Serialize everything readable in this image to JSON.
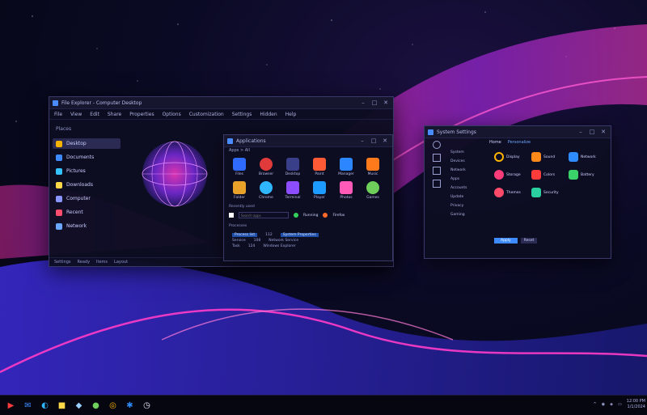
{
  "desktop": {
    "wallpaper": "neon-waves"
  },
  "explorer": {
    "title": "File Explorer - Computer Desktop",
    "menu": [
      "File",
      "View",
      "Edit",
      "Share",
      "Properties",
      "Options",
      "Customization",
      "Settings",
      "Hidden",
      "Help"
    ],
    "sidebar_header": "Places",
    "sidebar_items": [
      {
        "label": "Desktop",
        "icon": "folder-icon",
        "color": "#f4b400",
        "active": true
      },
      {
        "label": "Documents",
        "icon": "document-icon",
        "color": "#3d8bff",
        "active": false
      },
      {
        "label": "Pictures",
        "icon": "image-icon",
        "color": "#35c3ff",
        "active": false
      },
      {
        "label": "Downloads",
        "icon": "download-icon",
        "color": "#ffd84a",
        "active": false
      },
      {
        "label": "Computer",
        "icon": "computer-icon",
        "color": "#8a96ff",
        "active": false
      },
      {
        "label": "Recent",
        "icon": "clock-icon",
        "color": "#ff4d6d",
        "active": false
      },
      {
        "label": "Network",
        "icon": "network-icon",
        "color": "#6aa8ff",
        "active": false
      }
    ],
    "status_items": [
      "Settings",
      "Ready",
      "Items",
      "Layout"
    ]
  },
  "apps_window": {
    "title": "Applications",
    "path": "Apps > All",
    "grid": [
      {
        "label": "Files",
        "color": "#2f6bff"
      },
      {
        "label": "Browser",
        "color": "#e03a3a"
      },
      {
        "label": "Desktop",
        "color": "#3a3f8a"
      },
      {
        "label": "Paint",
        "color": "#ff5a36"
      },
      {
        "label": "Manager",
        "color": "#2c86ff"
      },
      {
        "label": "Music",
        "color": "#ff7a1a"
      },
      {
        "label": "Folder",
        "color": "#e8a22a"
      },
      {
        "label": "Chrome",
        "color": "#2fb6ff"
      },
      {
        "label": "Terminal",
        "color": "#8c4dff"
      },
      {
        "label": "Player",
        "color": "#1e9bff"
      },
      {
        "label": "Photos",
        "color": "#ff5ab8"
      },
      {
        "label": "Games",
        "color": "#6ed05a"
      }
    ],
    "section_label": "Recently used",
    "search_placeholder": "Search apps",
    "quick": [
      {
        "label": "Running",
        "color": "#35d05a"
      },
      {
        "label": "Firefox",
        "color": "#ff6a2a"
      }
    ],
    "list_header": "Processes",
    "rows": [
      {
        "name": "Process list",
        "num": "112",
        "info": "System Properties"
      },
      {
        "name": "Service",
        "num": "108",
        "info": "Network Service"
      },
      {
        "name": "Task",
        "num": "124",
        "info": "Windows Explorer"
      }
    ]
  },
  "control_panel": {
    "title": "System Settings",
    "tabs": [
      "Home",
      "Personalize"
    ],
    "left_items": [
      "System",
      "Devices",
      "Network",
      "Apps",
      "Accounts",
      "Update",
      "Privacy",
      "Gaming"
    ],
    "items": [
      {
        "label": "Display",
        "color": "#ffb400"
      },
      {
        "label": "Sound",
        "color": "#ff8a1a"
      },
      {
        "label": "Network",
        "color": "#2f8cff"
      },
      {
        "label": "Storage",
        "color": "#ff3c7a"
      },
      {
        "label": "Colors",
        "color": "#ff3b3b"
      },
      {
        "label": "Battery",
        "color": "#3ad06a"
      },
      {
        "label": "Themes",
        "color": "#ff4a6a"
      },
      {
        "label": "Security",
        "color": "#2ad0a0"
      }
    ],
    "apply_label": "Apply",
    "reset_label": "Reset"
  },
  "taskbar": {
    "apps": [
      {
        "name": "start",
        "glyph": "▶",
        "color": "#ff3b3b"
      },
      {
        "name": "mail",
        "glyph": "✉",
        "color": "#3d8bff"
      },
      {
        "name": "edge",
        "glyph": "◐",
        "color": "#2fb6ff"
      },
      {
        "name": "files",
        "glyph": "■",
        "color": "#ffd84a"
      },
      {
        "name": "store",
        "glyph": "◆",
        "color": "#9ad0ff"
      },
      {
        "name": "xbox",
        "glyph": "●",
        "color": "#6ed05a"
      },
      {
        "name": "photos",
        "glyph": "◎",
        "color": "#ffb400"
      },
      {
        "name": "settings",
        "glyph": "✱",
        "color": "#2f8cff"
      },
      {
        "name": "clock",
        "glyph": "◷",
        "color": "#e6e6ff"
      }
    ],
    "time": "12:00 PM",
    "date": "1/1/2024"
  }
}
